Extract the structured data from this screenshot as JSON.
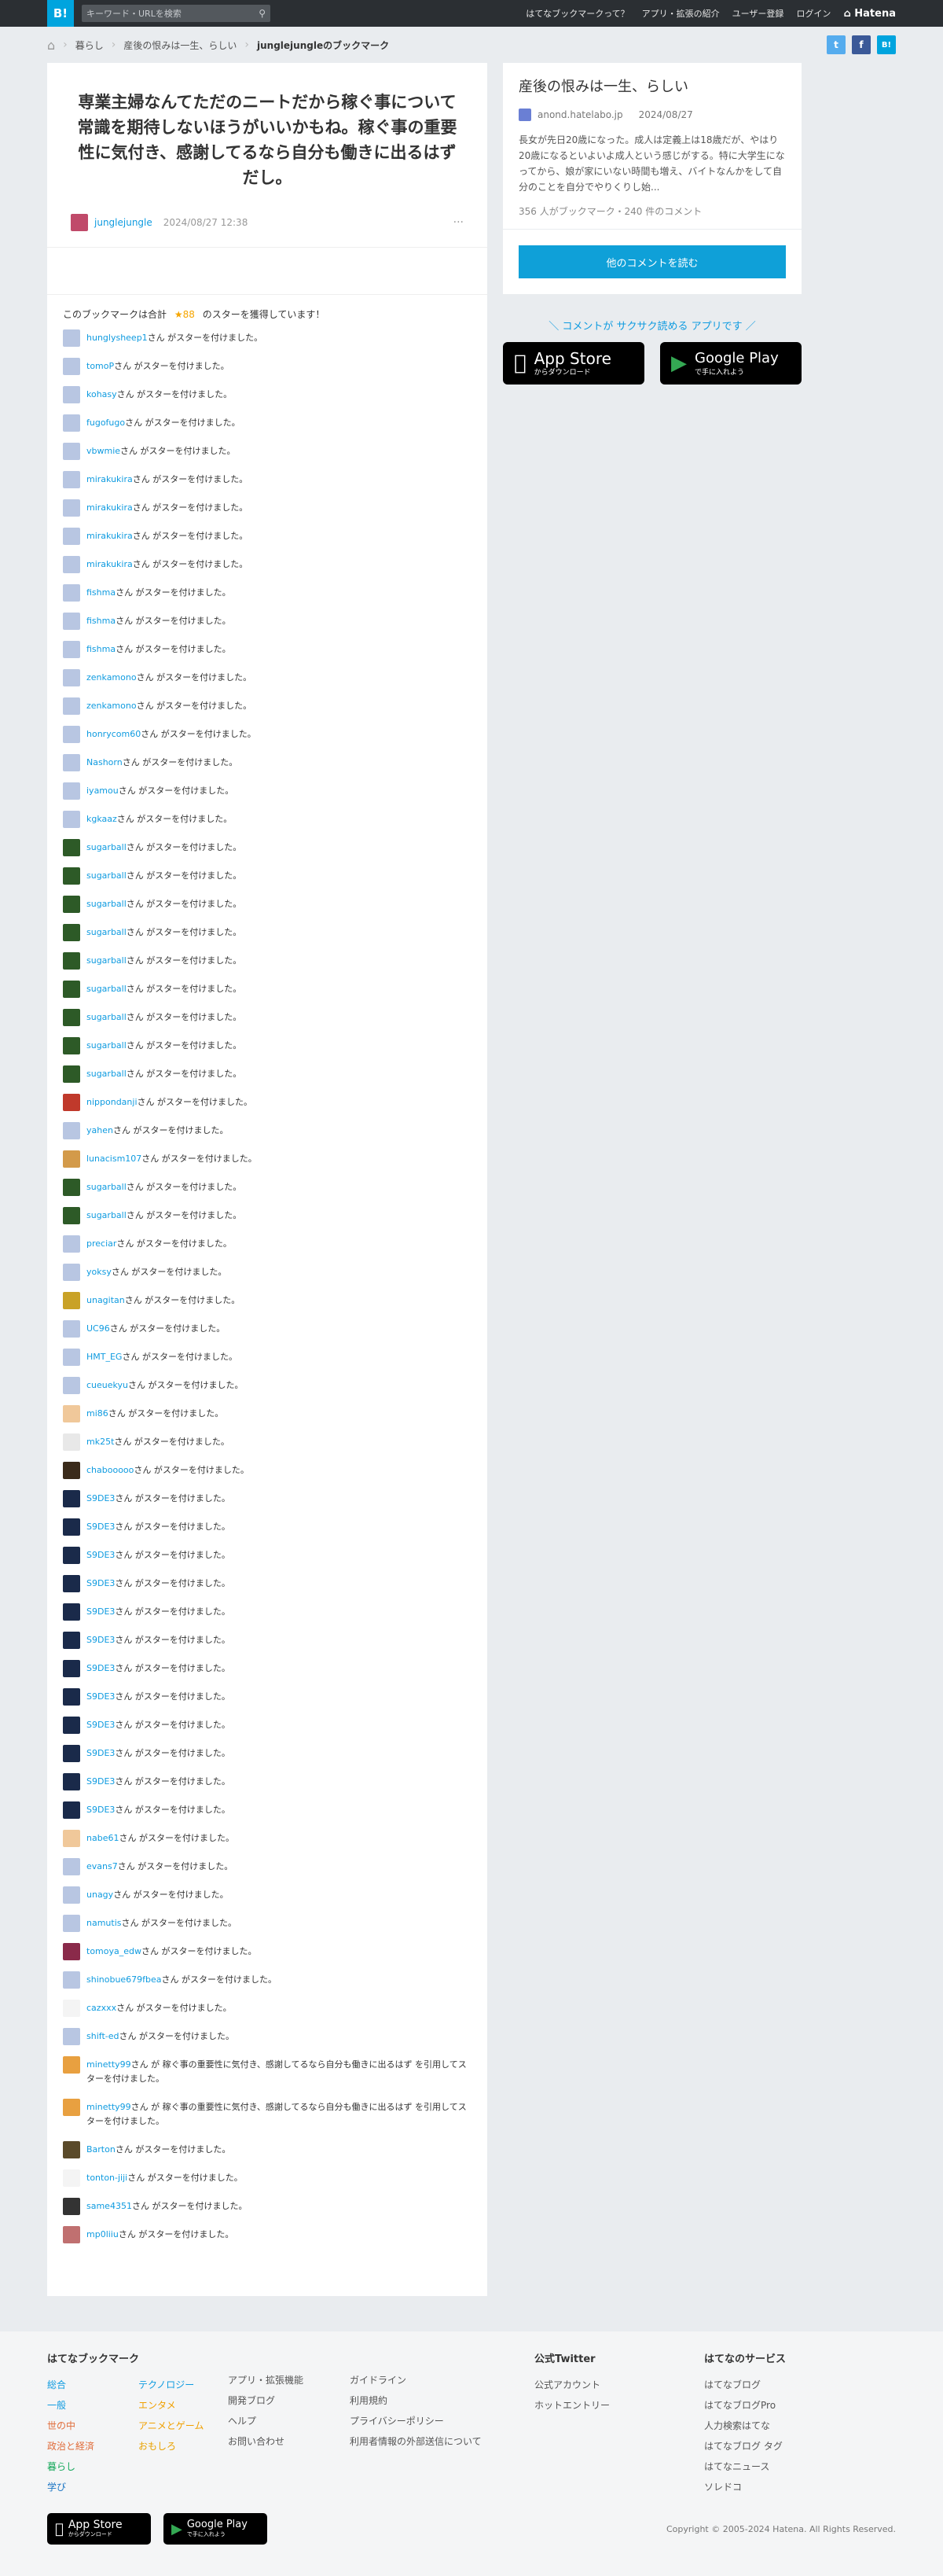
{
  "topbar": {
    "logo": "B!",
    "search_placeholder": "キーワード・URLを検索",
    "nav": [
      "はてなブックマークって？",
      "アプリ・拡張の紹介",
      "ユーザー登録",
      "ログイン"
    ],
    "brand": "Hatena"
  },
  "breadcrumb": {
    "items": [
      "暮らし",
      "産後の恨みは一生、らしい"
    ],
    "current": "junglejungleのブックマーク"
  },
  "share": {
    "twitter": "t",
    "facebook": "f",
    "hatena": "B!"
  },
  "entry": {
    "title": "専業主婦なんてただのニートだから稼ぐ事について常識を期待しないほうがいいかもね。稼ぐ事の重要性に気付き、感謝してるなら自分も働きに出るはずだし。",
    "user": "junglejungle",
    "date": "2024/08/27 12:38",
    "more": "···"
  },
  "stars": {
    "summary_prefix": "このブックマークは合計",
    "summary_count": "★88",
    "summary_suffix": "のスターを獲得しています！",
    "suffix": "さん がスターを付けました。",
    "rows": [
      {
        "user": "hunglysheep1",
        "text": "さん がスターを付けました。",
        "color": "#b8c6e2"
      },
      {
        "user": "tomoP",
        "text": "さん がスターを付けました。",
        "color": "#b8c6e2"
      },
      {
        "user": "kohasy",
        "text": "さん がスターを付けました。",
        "color": "#b8c6e2"
      },
      {
        "user": "fugofugo",
        "text": "さん がスターを付けました。",
        "color": "#b8c6e2"
      },
      {
        "user": "vbwmie",
        "text": "さん がスターを付けました。",
        "color": "#b8c6e2"
      },
      {
        "user": "mirakukira",
        "text": "さん がスターを付けました。",
        "color": "#b8c6e2"
      },
      {
        "user": "mirakukira",
        "text": "さん がスターを付けました。",
        "color": "#b8c6e2"
      },
      {
        "user": "mirakukira",
        "text": "さん がスターを付けました。",
        "color": "#b8c6e2"
      },
      {
        "user": "mirakukira",
        "text": "さん がスターを付けました。",
        "color": "#b8c6e2"
      },
      {
        "user": "fishma",
        "text": "さん がスターを付けました。",
        "color": "#b8c6e2"
      },
      {
        "user": "fishma",
        "text": "さん がスターを付けました。",
        "color": "#b8c6e2"
      },
      {
        "user": "fishma",
        "text": "さん がスターを付けました。",
        "color": "#b8c6e2"
      },
      {
        "user": "zenkamono",
        "text": "さん がスターを付けました。",
        "color": "#b8c6e2"
      },
      {
        "user": "zenkamono",
        "text": "さん がスターを付けました。",
        "color": "#b8c6e2"
      },
      {
        "user": "honrycom60",
        "text": "さん がスターを付けました。",
        "color": "#b8c6e2"
      },
      {
        "user": "Nashorn",
        "text": "さん がスターを付けました。",
        "color": "#b8c6e2"
      },
      {
        "user": "iyamou",
        "text": "さん がスターを付けました。",
        "color": "#b8c6e2"
      },
      {
        "user": "kgkaaz",
        "text": "さん がスターを付けました。",
        "color": "#b8c6e2"
      },
      {
        "user": "sugarball",
        "text": "さん がスターを付けました。",
        "color": "#2d5a27"
      },
      {
        "user": "sugarball",
        "text": "さん がスターを付けました。",
        "color": "#2d5a27"
      },
      {
        "user": "sugarball",
        "text": "さん がスターを付けました。",
        "color": "#2d5a27"
      },
      {
        "user": "sugarball",
        "text": "さん がスターを付けました。",
        "color": "#2d5a27"
      },
      {
        "user": "sugarball",
        "text": "さん がスターを付けました。",
        "color": "#2d5a27"
      },
      {
        "user": "sugarball",
        "text": "さん がスターを付けました。",
        "color": "#2d5a27"
      },
      {
        "user": "sugarball",
        "text": "さん がスターを付けました。",
        "color": "#2d5a27"
      },
      {
        "user": "sugarball",
        "text": "さん がスターを付けました。",
        "color": "#2d5a27"
      },
      {
        "user": "sugarball",
        "text": "さん がスターを付けました。",
        "color": "#2d5a27"
      },
      {
        "user": "nippondanji",
        "text": "さん がスターを付けました。",
        "color": "#c0392b"
      },
      {
        "user": "yahen",
        "text": "さん がスターを付けました。",
        "color": "#b8c6e2"
      },
      {
        "user": "lunacism107",
        "text": "さん がスターを付けました。",
        "color": "#d39a4a"
      },
      {
        "user": "sugarball",
        "text": "さん がスターを付けました。",
        "color": "#2d5a27"
      },
      {
        "user": "sugarball",
        "text": "さん がスターを付けました。",
        "color": "#2d5a27"
      },
      {
        "user": "preciar",
        "text": "さん がスターを付けました。",
        "color": "#b8c6e2"
      },
      {
        "user": "yoksy",
        "text": "さん がスターを付けました。",
        "color": "#b8c6e2"
      },
      {
        "user": "unagitan",
        "text": "さん がスターを付けました。",
        "color": "#c9a227"
      },
      {
        "user": "UC96",
        "text": "さん がスターを付けました。",
        "color": "#b8c6e2"
      },
      {
        "user": "HMT_EG",
        "text": "さん がスターを付けました。",
        "color": "#b8c6e2"
      },
      {
        "user": "cueuekyu",
        "text": "さん がスターを付けました。",
        "color": "#b8c6e2"
      },
      {
        "user": "mi86",
        "text": "さん がスターを付けました。",
        "color": "#f0c89a"
      },
      {
        "user": "mk25t",
        "text": "さん がスターを付けました。",
        "color": "#e8e8e8"
      },
      {
        "user": "chabooooo",
        "text": "さん がスターを付けました。",
        "color": "#3a2a1a"
      },
      {
        "user": "S9DE3",
        "text": "さん がスターを付けました。",
        "color": "#1a2a4a"
      },
      {
        "user": "S9DE3",
        "text": "さん がスターを付けました。",
        "color": "#1a2a4a"
      },
      {
        "user": "S9DE3",
        "text": "さん がスターを付けました。",
        "color": "#1a2a4a"
      },
      {
        "user": "S9DE3",
        "text": "さん がスターを付けました。",
        "color": "#1a2a4a"
      },
      {
        "user": "S9DE3",
        "text": "さん がスターを付けました。",
        "color": "#1a2a4a"
      },
      {
        "user": "S9DE3",
        "text": "さん がスターを付けました。",
        "color": "#1a2a4a"
      },
      {
        "user": "S9DE3",
        "text": "さん がスターを付けました。",
        "color": "#1a2a4a"
      },
      {
        "user": "S9DE3",
        "text": "さん がスターを付けました。",
        "color": "#1a2a4a"
      },
      {
        "user": "S9DE3",
        "text": "さん がスターを付けました。",
        "color": "#1a2a4a"
      },
      {
        "user": "S9DE3",
        "text": "さん がスターを付けました。",
        "color": "#1a2a4a"
      },
      {
        "user": "S9DE3",
        "text": "さん がスターを付けました。",
        "color": "#1a2a4a"
      },
      {
        "user": "S9DE3",
        "text": "さん がスターを付けました。",
        "color": "#1a2a4a"
      },
      {
        "user": "nabe61",
        "text": "さん がスターを付けました。",
        "color": "#f0c89a"
      },
      {
        "user": "evans7",
        "text": "さん がスターを付けました。",
        "color": "#b8c6e2"
      },
      {
        "user": "unagy",
        "text": "さん がスターを付けました。",
        "color": "#b8c6e2"
      },
      {
        "user": "namutis",
        "text": "さん がスターを付けました。",
        "color": "#b8c6e2"
      },
      {
        "user": "tomoya_edw",
        "text": "さん がスターを付けました。",
        "color": "#8a2a4a"
      },
      {
        "user": "shinobue679fbea",
        "text": "さん がスターを付けました。",
        "color": "#b8c6e2"
      },
      {
        "user": "cazxxx",
        "text": "さん がスターを付けました。",
        "color": "#f4f4f4"
      },
      {
        "user": "shift-ed",
        "text": "さん がスターを付けました。",
        "color": "#b8c6e2"
      },
      {
        "user": "minetty99",
        "text": "さん が 稼ぐ事の重要性に気付き、感謝してるなら自分も働きに出るはず を引用してスターを付けました。",
        "color": "#e8a040"
      },
      {
        "user": "minetty99",
        "text": "さん が 稼ぐ事の重要性に気付き、感謝してるなら自分も働きに出るはず を引用してスターを付けました。",
        "color": "#e8a040"
      },
      {
        "user": "Barton",
        "text": "さん がスターを付けました。",
        "color": "#5a4a2a"
      },
      {
        "user": "tonton-jiji",
        "text": "さん がスターを付けました。",
        "color": "#f4f4f4"
      },
      {
        "user": "same4351",
        "text": "さん がスターを付けました。",
        "color": "#333333"
      },
      {
        "user": "mp0liiu",
        "text": "さん がスターを付けました。",
        "color": "#c07070"
      }
    ]
  },
  "sidebar": {
    "title": "産後の恨みは一生、らしい",
    "domain": "anond.hatelabo.jp",
    "date": "2024/08/27",
    "description": "長女が先日20歳になった。成人は定義上は18歳だが、やはり20歳になるといよいよ成人という感じがする。特に大学生になってから、娘が家にいない時間も増え、バイトなんかをして自分のことを自分でやりくりし始...",
    "count": "356 人がブックマーク・240 件のコメント",
    "button": "他のコメントを読む",
    "promo": "＼ コメントが サクサク読める アプリです ／",
    "appstore_top": "App Store",
    "appstore_sub": "からダウンロード",
    "googleplay_top": "Google Play",
    "googleplay_sub": "で手に入れよう"
  },
  "footer": {
    "col1_title": "はてなブックマーク",
    "col1a": [
      {
        "label": "総合",
        "color": "#0f9be0"
      },
      {
        "label": "一般",
        "color": "#0f9be0"
      },
      {
        "label": "世の中",
        "color": "#e06c3a"
      },
      {
        "label": "政治と経済",
        "color": "#e06c3a"
      },
      {
        "label": "暮らし",
        "color": "#14a85a"
      },
      {
        "label": "学び",
        "color": "#1b75c4"
      }
    ],
    "col1b": [
      {
        "label": "テクノロジー",
        "color": "#0f9be0"
      },
      {
        "label": "エンタメ",
        "color": "#f0a000"
      },
      {
        "label": "アニメとゲーム",
        "color": "#f0a000"
      },
      {
        "label": "おもしろ",
        "color": "#e9a200"
      }
    ],
    "col2": [
      "アプリ・拡張機能",
      "開発ブログ",
      "ヘルプ",
      "お問い合わせ"
    ],
    "col3": [
      "ガイドライン",
      "利用規約",
      "プライバシーポリシー",
      "利用者情報の外部送信について"
    ],
    "col4_title": "公式Twitter",
    "col4": [
      "公式アカウント",
      "ホットエントリー"
    ],
    "col5_title": "はてなのサービス",
    "col5": [
      "はてなブログ",
      "はてなブログPro",
      "人力検索はてな",
      "はてなブログ タグ",
      "はてなニュース",
      "ソレドコ"
    ],
    "appstore_top": "App Store",
    "appstore_sub": "からダウンロード",
    "googleplay_top": "Google Play",
    "googleplay_sub": "で手に入れよう",
    "copyright": "Copyright © 2005-2024 Hatena. All Rights Reserved."
  },
  "colors": {
    "accent": "#0f9be0",
    "topbar": "#2b2f33",
    "star": "#f6a600",
    "button": "#0fa0d8"
  }
}
